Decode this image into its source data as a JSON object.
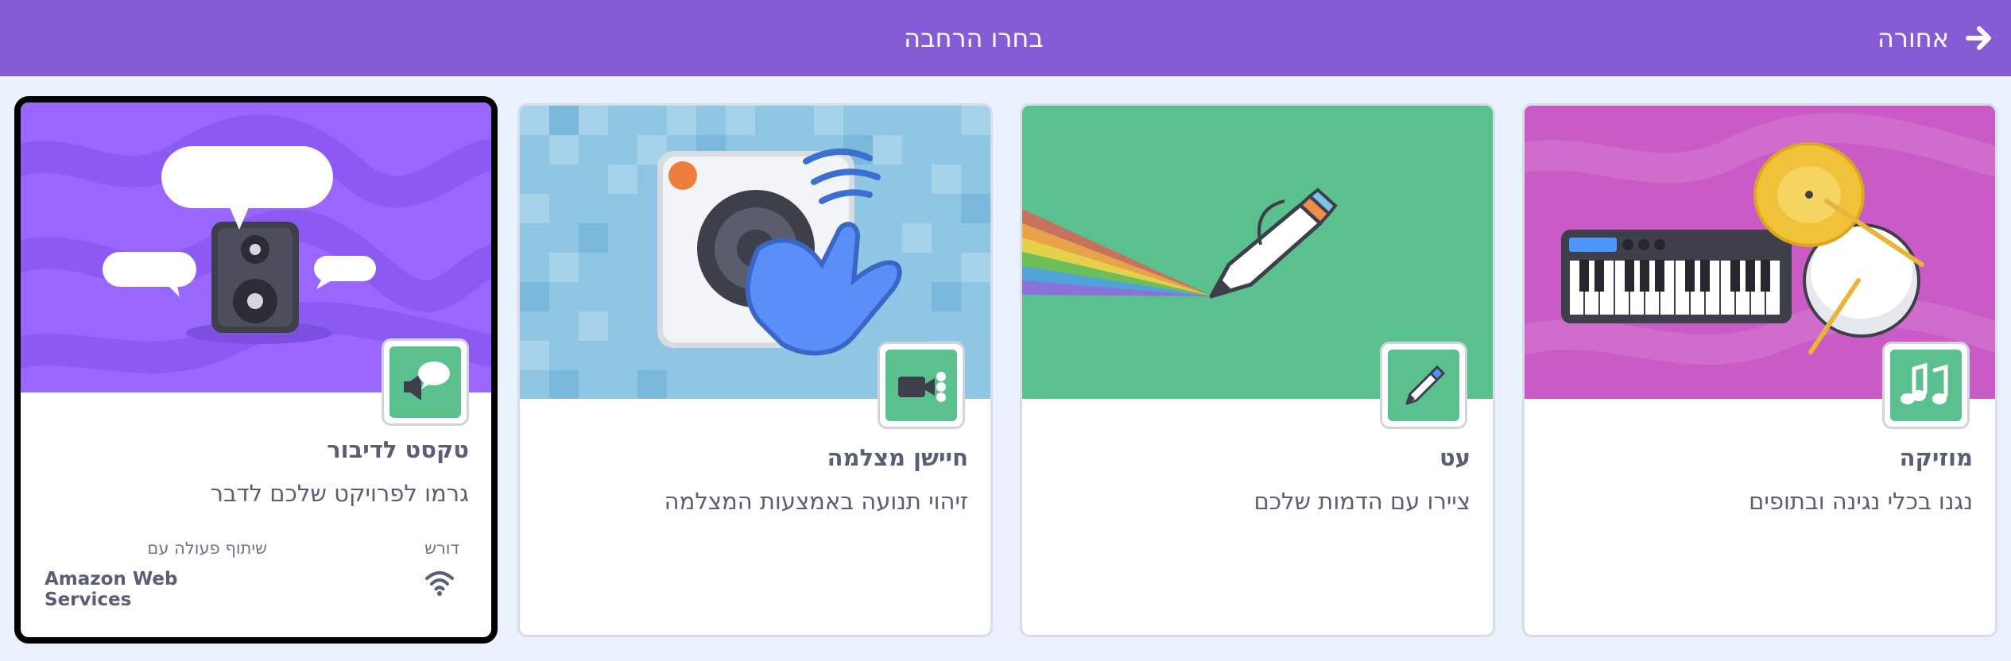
{
  "header": {
    "title": "בחרו הרחבה",
    "back_label": "אחורה",
    "back_icon": "arrow-right-icon",
    "background": "#855cd6"
  },
  "cards": [
    {
      "id": "music",
      "title": "מוזיקה",
      "description": "נגנו בכלי נגינה ובתופים",
      "icon": "music-notes-icon",
      "image": "piano-drum-illustration",
      "image_color": "#c95ac6"
    },
    {
      "id": "pen",
      "title": "עט",
      "description": "ציירו עם הדמות שלכם",
      "icon": "pen-icon",
      "image": "rainbow-pen-illustration",
      "image_color": "#59c08e"
    },
    {
      "id": "video-sensing",
      "title": "חיישן מצלמה",
      "description": "זיהוי תנועה באמצעות המצלמה",
      "icon": "video-camera-icon",
      "image": "camera-hand-illustration",
      "image_color": "#8fc6e3"
    },
    {
      "id": "text-to-speech",
      "title": "טקסט לדיבור",
      "description": "גרמו לפרויקט שלכם לדבר",
      "icon": "speech-speaker-icon",
      "image": "speaker-speech-bubbles-illustration",
      "image_color": "#9966ff",
      "selected": true,
      "requires_label": "דורש",
      "requires_icon": "wifi-icon",
      "collaboration_label": "שיתוף פעולה עם",
      "collaboration_value": "Amazon Web Services"
    }
  ],
  "colors": {
    "page_background": "#e9f1fc",
    "text": "#575e75",
    "extension_green": "#59c08e"
  }
}
